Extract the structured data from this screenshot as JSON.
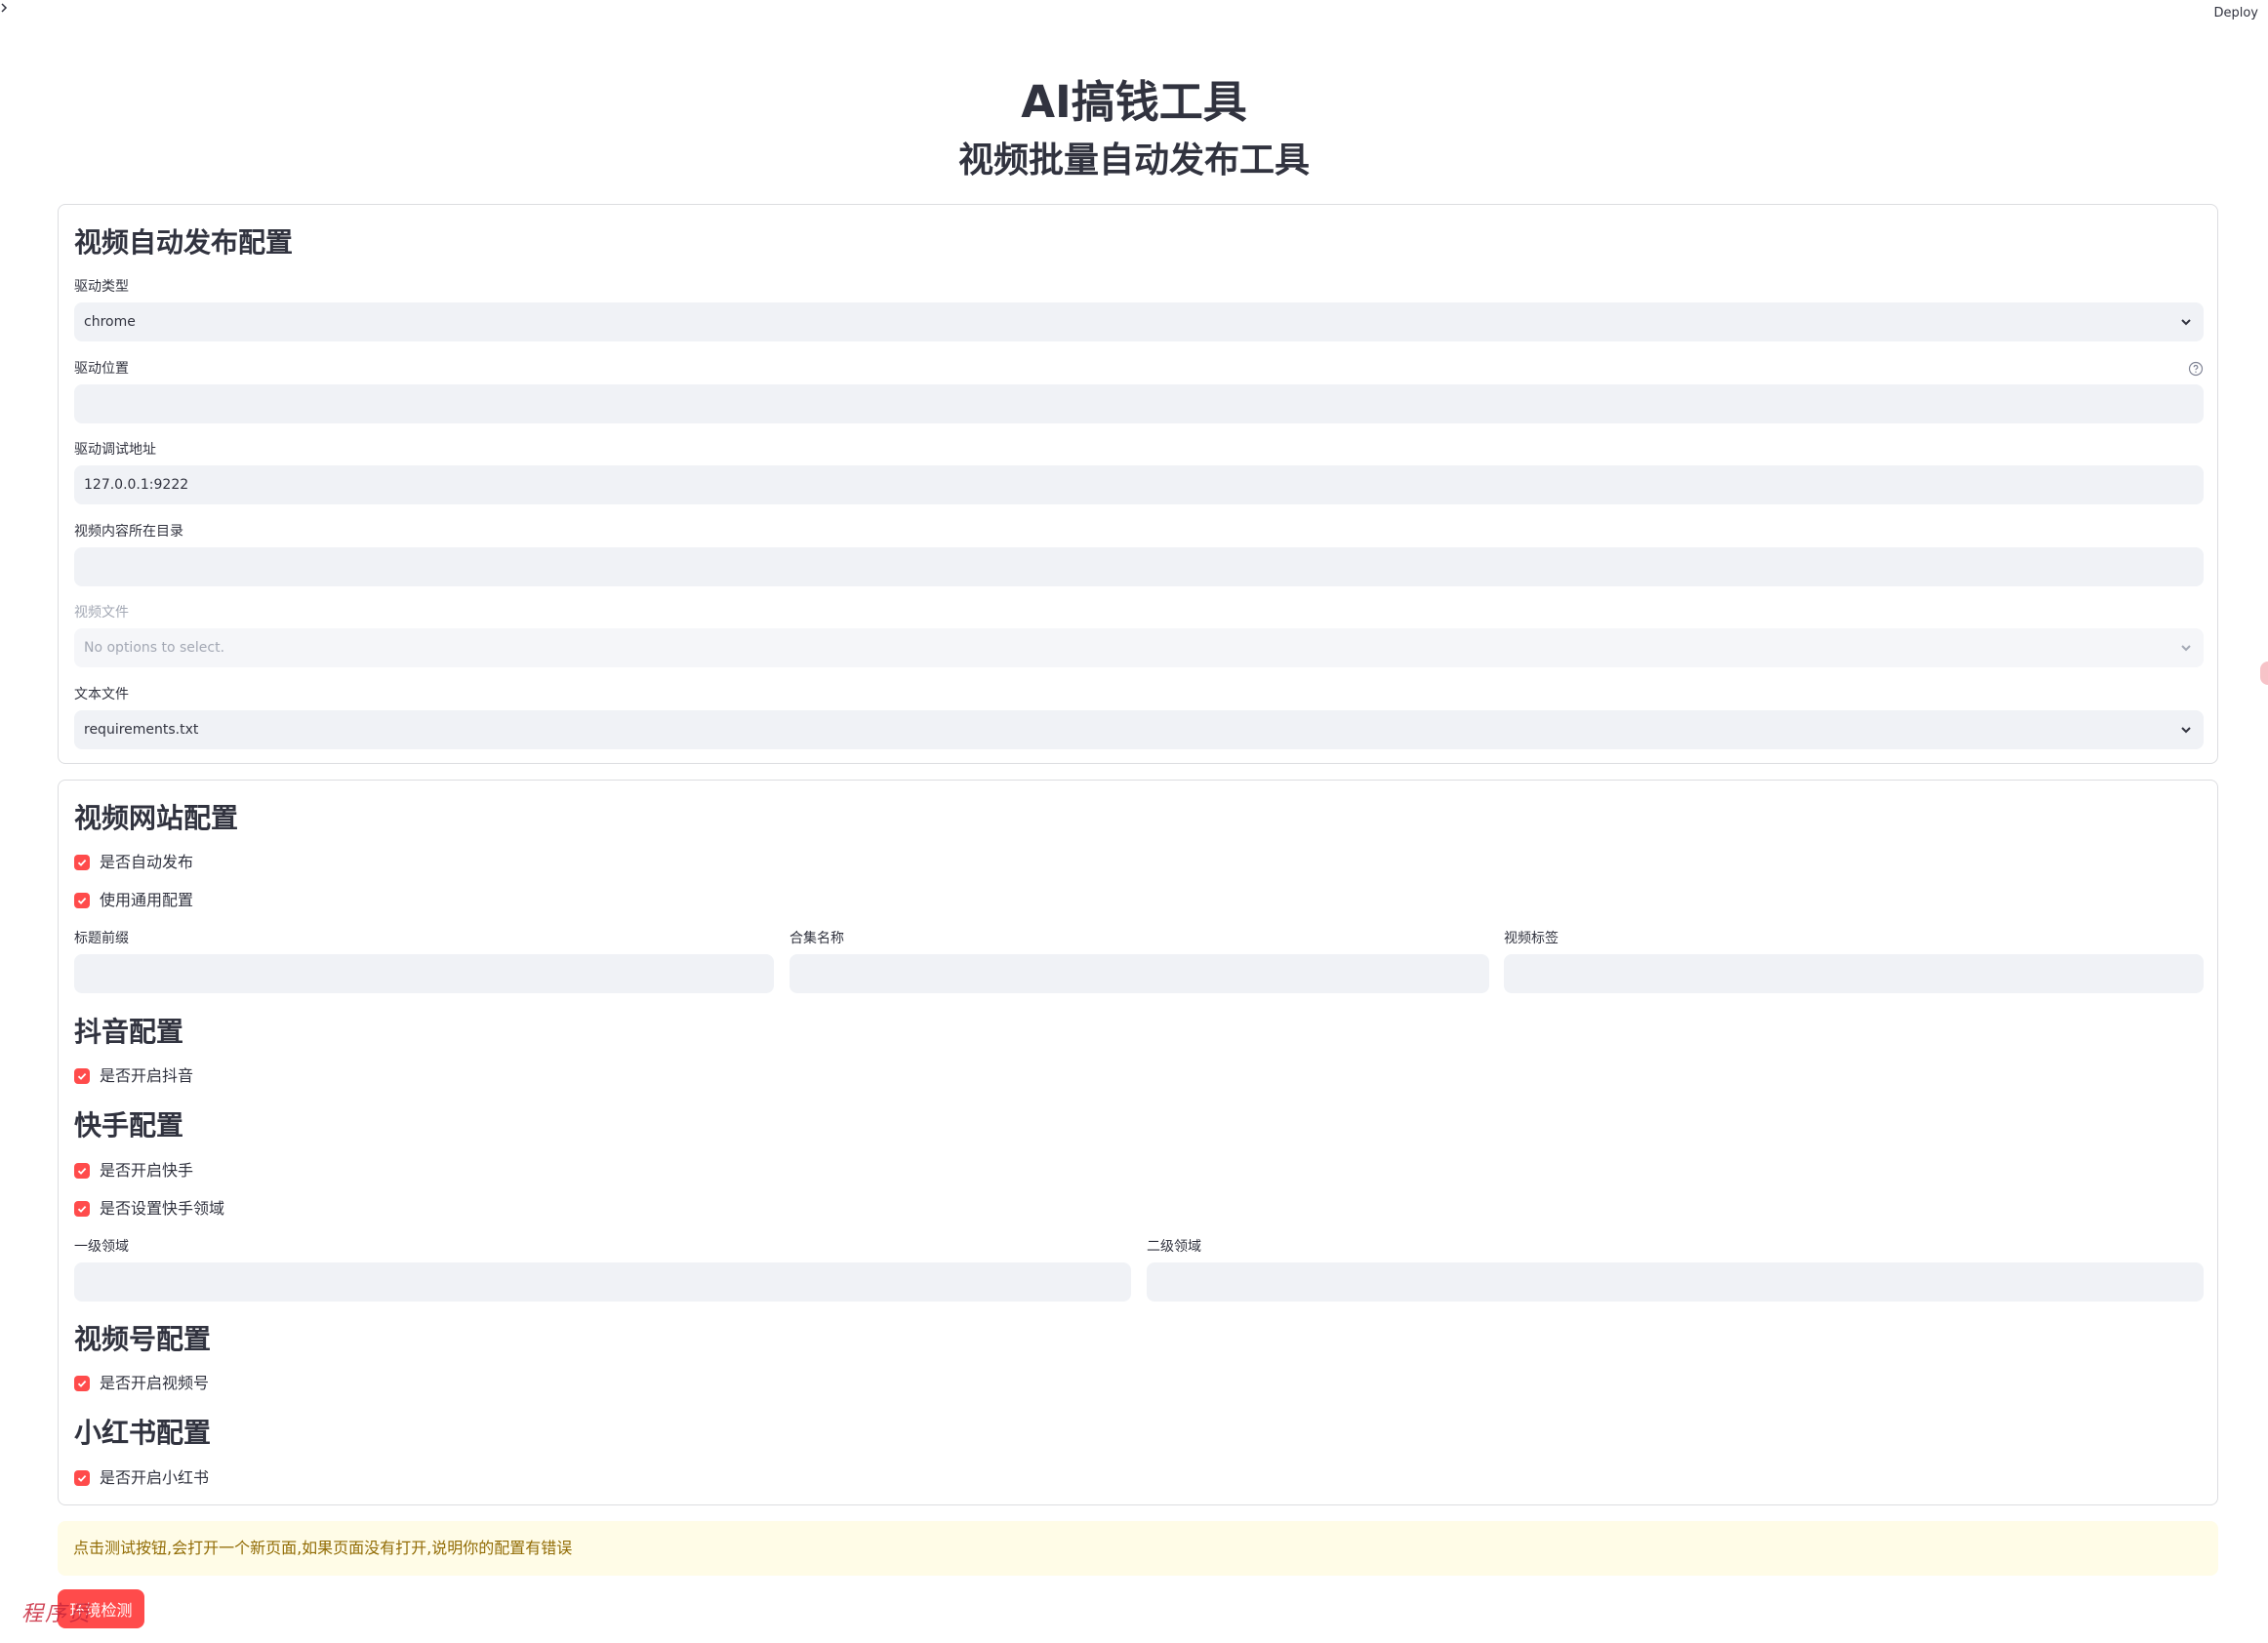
{
  "header": {
    "deploy_label": "Deploy"
  },
  "title": "AI搞钱工具",
  "subtitle": "视频批量自动发布工具",
  "publish_config": {
    "title": "视频自动发布配置",
    "driver_type": {
      "label": "驱动类型",
      "value": "chrome"
    },
    "driver_location": {
      "label": "驱动位置",
      "value": ""
    },
    "driver_debug_address": {
      "label": "驱动调试地址",
      "value": "127.0.0.1:9222"
    },
    "video_dir": {
      "label": "视频内容所在目录",
      "value": ""
    },
    "video_file": {
      "label": "视频文件",
      "placeholder": "No options to select."
    },
    "text_file": {
      "label": "文本文件",
      "value": "requirements.txt"
    }
  },
  "site_config": {
    "title": "视频网站配置",
    "auto_publish": {
      "label": "是否自动发布",
      "checked": true
    },
    "use_common": {
      "label": "使用通用配置",
      "checked": true
    },
    "title_prefix": {
      "label": "标题前缀",
      "value": ""
    },
    "collection_name": {
      "label": "合集名称",
      "value": ""
    },
    "video_tags": {
      "label": "视频标签",
      "value": ""
    },
    "douyin": {
      "title": "抖音配置",
      "enable": {
        "label": "是否开启抖音",
        "checked": true
      }
    },
    "kuaishou": {
      "title": "快手配置",
      "enable": {
        "label": "是否开启快手",
        "checked": true
      },
      "set_domain": {
        "label": "是否设置快手领域",
        "checked": true
      },
      "domain_level1": {
        "label": "一级领域",
        "value": ""
      },
      "domain_level2": {
        "label": "二级领域",
        "value": ""
      }
    },
    "shipinhao": {
      "title": "视频号配置",
      "enable": {
        "label": "是否开启视频号",
        "checked": true
      }
    },
    "xiaohongshu": {
      "title": "小红书配置",
      "enable": {
        "label": "是否开启小红书",
        "checked": true
      }
    }
  },
  "notice": "点击测试按钮,会打开一个新页面,如果页面没有打开,说明你的配置有错误",
  "test_button": "环境检测",
  "watermark": "程序员",
  "colors": {
    "accent": "#ff4b4b",
    "input_bg": "#f0f2f6",
    "notice_bg": "#fffce7",
    "notice_text": "#926c05"
  }
}
